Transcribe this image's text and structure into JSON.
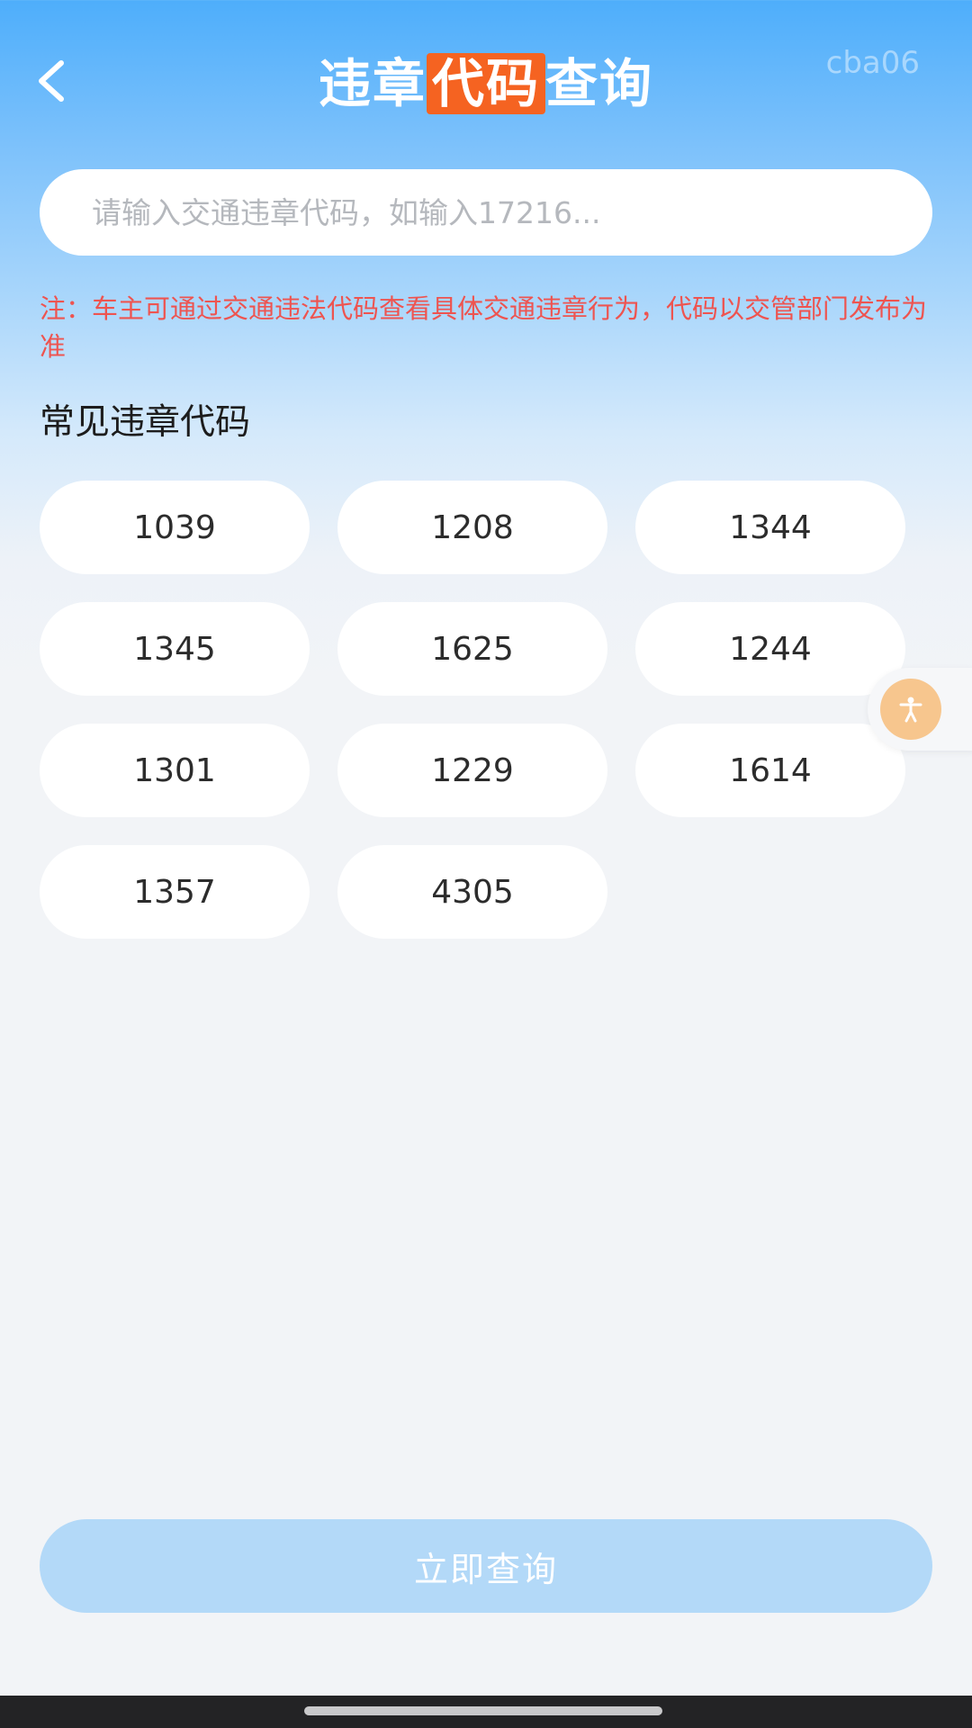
{
  "header": {
    "title_part1": "违章",
    "title_highlight": "代码",
    "title_part2": "查询",
    "watermark": "cba06",
    "back_icon": "chevron-left-icon"
  },
  "search": {
    "placeholder": "请输入交通违章代码，如输入17216...",
    "value": ""
  },
  "note": "注：车主可通过交通违法代码查看具体交通违章行为，代码以交管部门发布为准",
  "section_title": "常见违章代码",
  "codes": [
    "1039",
    "1208",
    "1344",
    "1345",
    "1625",
    "1244",
    "1301",
    "1229",
    "1614",
    "1357",
    "4305"
  ],
  "float_button": {
    "icon": "accessibility-icon"
  },
  "query_button": {
    "label": "立即查询"
  },
  "colors": {
    "accent": "#f56321",
    "note_red": "#ee5450",
    "query_button_bg": "#b3d9f8",
    "float_icon_bg": "#f7c68e"
  }
}
